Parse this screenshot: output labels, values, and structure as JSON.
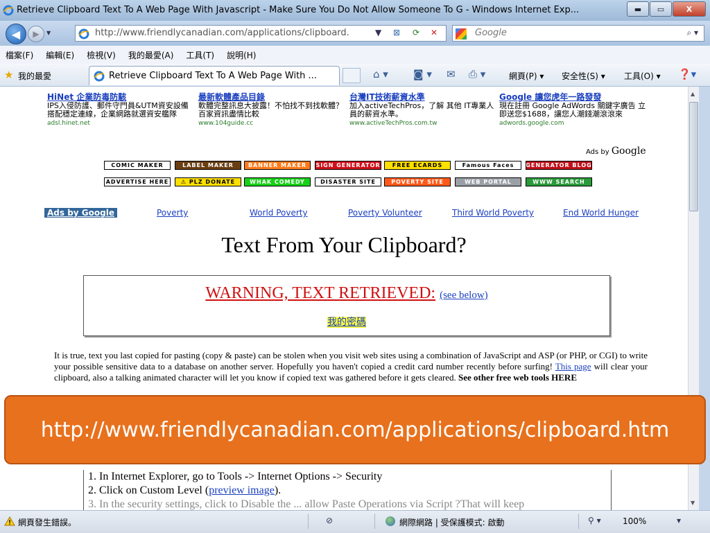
{
  "window": {
    "title": "Retrieve Clipboard Text To A Web Page With Javascript - Make Sure You Do Not Allow Someone To G - Windows Internet Exp...",
    "min_label": "▬",
    "max_label": "▭",
    "close_label": "X"
  },
  "address_bar": {
    "url": "http://www.friendlycanadian.com/applications/clipboard.",
    "search_placeholder": "Google"
  },
  "menu": {
    "items": [
      "檔案(F)",
      "編輯(E)",
      "檢視(V)",
      "我的最愛(A)",
      "工具(T)",
      "說明(H)"
    ]
  },
  "favorites_bar": {
    "label": "我的最愛",
    "tab_title": "Retrieve Clipboard Text To A Web Page With ...",
    "cmd_page": "網頁(P) ▾",
    "cmd_safety": "安全性(S) ▾",
    "cmd_tools": "工具(O) ▾"
  },
  "ads": [
    {
      "title": "HiNet 企業防毒防駭",
      "desc": "IPS入侵防護、郵件守門員&UTM資安設備 搭配穩定連線，企業網路就選資安艦隊",
      "url": "adsl.hinet.net"
    },
    {
      "title": "最新軟體產品目錄",
      "desc": "軟體完整訊息大披露！不怕找不到找軟體？百家資訊盡情比較",
      "url": "www.104guide.cc"
    },
    {
      "title": "台灣IT技術薪資水準",
      "desc": "加入activeTechPros，了解 其他 IT專業人員的薪資水準。",
      "url": "www.activeTechPros.com.tw"
    },
    {
      "title": "Google 讓您虎年一路發發",
      "desc": "現在註冊 Google AdWords 關鍵字廣告 立即送您$1688，讓您人潮錢潮滾滾來",
      "url": "adwords.google.com"
    }
  ],
  "ads_by": {
    "prefix": "Ads by",
    "brand": "Google"
  },
  "banners_row1": [
    {
      "label": "COMIC MAKER"
    },
    {
      "label": "LABEL MAKER"
    },
    {
      "label": "BANNER MAKER"
    },
    {
      "label": "SIGN GENERATOR"
    },
    {
      "label": "FREE ECARDS"
    },
    {
      "label": "Famous Faces"
    },
    {
      "label": "GENERATOR BLOG"
    }
  ],
  "banners_row2": [
    {
      "label": "ADVERTISE HERE"
    },
    {
      "label": "⚠ PLZ DONATE"
    },
    {
      "label": "WHAK COMEDY"
    },
    {
      "label": "DISASTER SITE"
    },
    {
      "label": "POVERTY SITE"
    },
    {
      "label": "WEB PORTAL"
    },
    {
      "label": "WWW SEARCH"
    }
  ],
  "ad_links": [
    "Ads by Google",
    "Poverty",
    "World Poverty",
    "Poverty Volunteer",
    "Third World Poverty",
    "End World Hunger"
  ],
  "page": {
    "title": "Text From Your Clipboard?",
    "warning": "WARNING, TEXT RETRIEVED:",
    "see_below": "(see below)",
    "clipboard_text": "我的密碼",
    "para_1": "It is true, text you last copied for pasting (copy & paste) can be stolen when you visit web sites using a combination of JavaScript and ASP (or PHP, or CGI) to write your possible sensitive data to a database on another server. Hopefully you haven't copied a credit card number recently before surfing!",
    "para_link": "This page",
    "para_2": "will clear your clipboard, also a talking animated character will let you know if copied text was gathered before it gets cleared.",
    "para_3": "See other free web tools HERE",
    "step_1": "1. In Internet Explorer, go to Tools -> Internet Options -> Security",
    "step_2_prefix": "2. Click on Custom Level (",
    "step_2_link": "preview image",
    "step_2_suffix": ").",
    "step_3": "3. In the security settings, click to Disable the ... allow Paste Operations via Script ?That will keep"
  },
  "overlay_url": "http://www.friendlycanadian.com/applications/clipboard.htm",
  "status": {
    "error_text": "網頁發生錯誤。",
    "zone": "網際網路 | 受保護模式: 啟動",
    "zoom": "100%"
  }
}
